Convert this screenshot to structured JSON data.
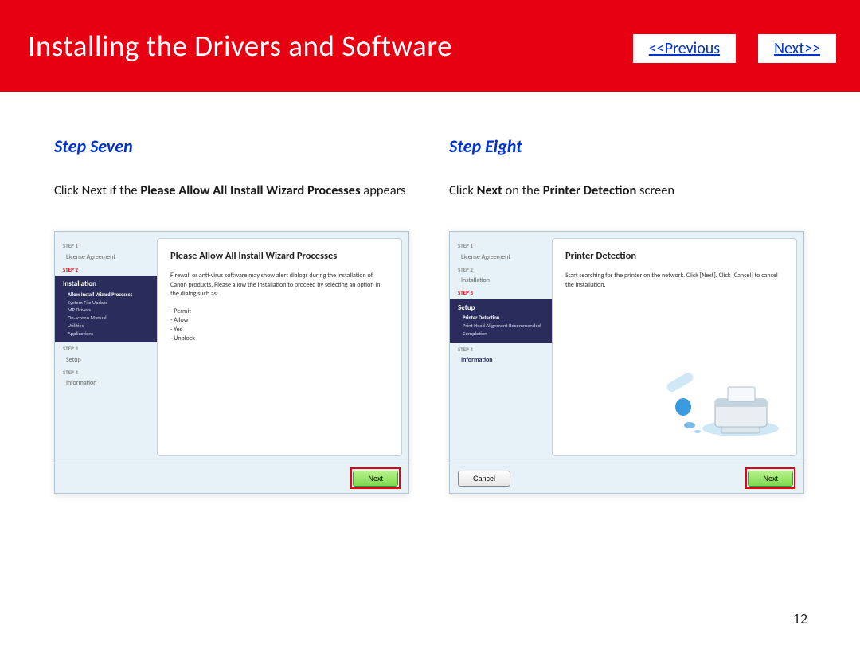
{
  "header": {
    "title": "Installing  the Drivers and Software",
    "prev": "<<Previous",
    "next": "Next>>"
  },
  "left": {
    "stepTitle": "Step Seven",
    "desc_pre": "Click Next if the ",
    "desc_bold": "Please Allow All Install Wizard Processes",
    "desc_post": " appears",
    "wizard": {
      "title": "Please Allow All Install Wizard Processes",
      "body": "Firewall or anti-virus software may show alert dialogs during the installation of Canon products. Please allow the installation to proceed by selecting an option in the dialog such as:",
      "opts": [
        "- Permit",
        "- Allow",
        "- Yes",
        "- Unblock"
      ],
      "sidebar": {
        "s1": "STEP 1",
        "s1i": "License Agreement",
        "s2": "STEP 2",
        "active_hdr": "Installation",
        "active_subs": [
          "Allow Install Wizard Processes",
          "System File Update",
          "MP Drivers",
          "On-screen Manual",
          "Utilities",
          "Applications"
        ],
        "s3": "STEP 3",
        "s3i": "Setup",
        "s4": "STEP 4",
        "s4i": "Information"
      },
      "nextBtn": "Next"
    }
  },
  "right": {
    "stepTitle": "Step Eight",
    "desc_pre": "Click ",
    "desc_b1": "Next",
    "desc_mid": " on the ",
    "desc_b2": "Printer Detection",
    "desc_post": " screen",
    "wizard": {
      "title": "Printer Detection",
      "body": "Start searching for the printer on the network. Click [Next]. Click [Cancel] to cancel the installation.",
      "sidebar": {
        "s1": "STEP 1",
        "s1i": "License Agreement",
        "s2": "STEP 2",
        "s2i": "Installation",
        "s3": "STEP 3",
        "active_hdr": "Setup",
        "active_subs": [
          "Printer Detection",
          "Print Head Alignment Recommended",
          "Completion"
        ],
        "s4": "STEP 4",
        "s4i": "Information"
      },
      "cancelBtn": "Cancel",
      "nextBtn": "Next"
    }
  },
  "pageNumber": "12"
}
